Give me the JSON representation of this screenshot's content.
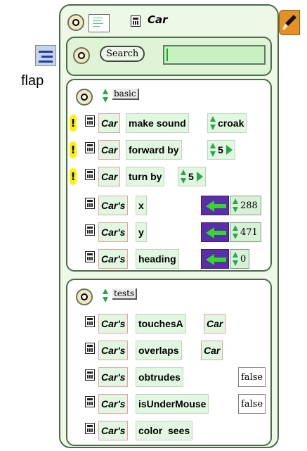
{
  "flap": {
    "label": "flap"
  },
  "viewer": {
    "object_name": "Car"
  },
  "search": {
    "button_label": "Search",
    "field_value": ""
  },
  "categories": {
    "basic": {
      "name": "basic",
      "rows": [
        {
          "object": "Car",
          "command": "make sound",
          "argument": "croak"
        },
        {
          "object": "Car",
          "command": "forward by",
          "argument": "5"
        },
        {
          "object": "Car",
          "command": "turn by",
          "argument": "5"
        },
        {
          "object": "Car's",
          "slot": "x",
          "value": "288"
        },
        {
          "object": "Car's",
          "slot": "y",
          "value": "471"
        },
        {
          "object": "Car's",
          "slot": "heading",
          "value": "0"
        }
      ]
    },
    "tests": {
      "name": "tests",
      "rows": [
        {
          "object": "Car's",
          "slot": "touchesA",
          "value": "Car"
        },
        {
          "object": "Car's",
          "slot": "overlaps",
          "value": "Car"
        },
        {
          "object": "Car's",
          "slot": "obtrudes",
          "value": "false"
        },
        {
          "object": "Car's",
          "slot": "isUnderMouse",
          "value": "false"
        },
        {
          "object": "Car's",
          "slot": "color  sees",
          "value": ""
        }
      ]
    }
  }
}
